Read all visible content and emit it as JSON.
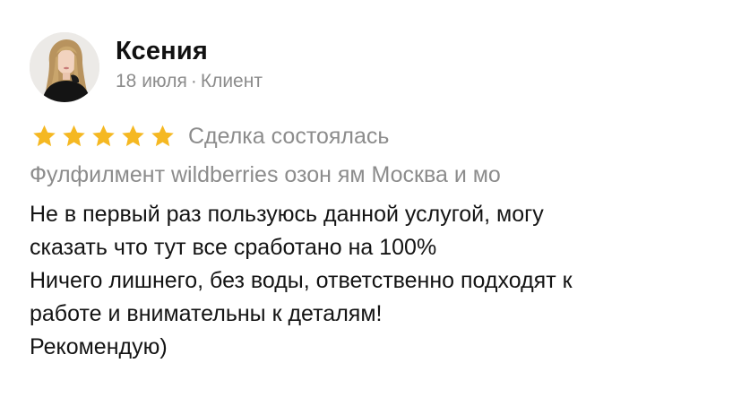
{
  "review": {
    "author": "Ксения",
    "date": "18 июля",
    "separator": "·",
    "role": "Клиент",
    "rating": 5,
    "rating_max": 5,
    "status": "Сделка состоялась",
    "service": "Фулфилмент wildberries озон ям Москва и мо",
    "text_lines": [
      "Не в первый раз пользуюсь данной услугой, могу",
      "сказать что тут все сработано на 100%",
      "Ничего лишнего, без воды, ответственно подходят к",
      "работе и внимательны к деталям!",
      "Рекомендую)"
    ]
  },
  "colors": {
    "star": "#f5b822",
    "muted_text": "#8c8c8c",
    "name_text": "#111111"
  },
  "icons": {
    "avatar": "user-photo",
    "star": "star-icon"
  }
}
